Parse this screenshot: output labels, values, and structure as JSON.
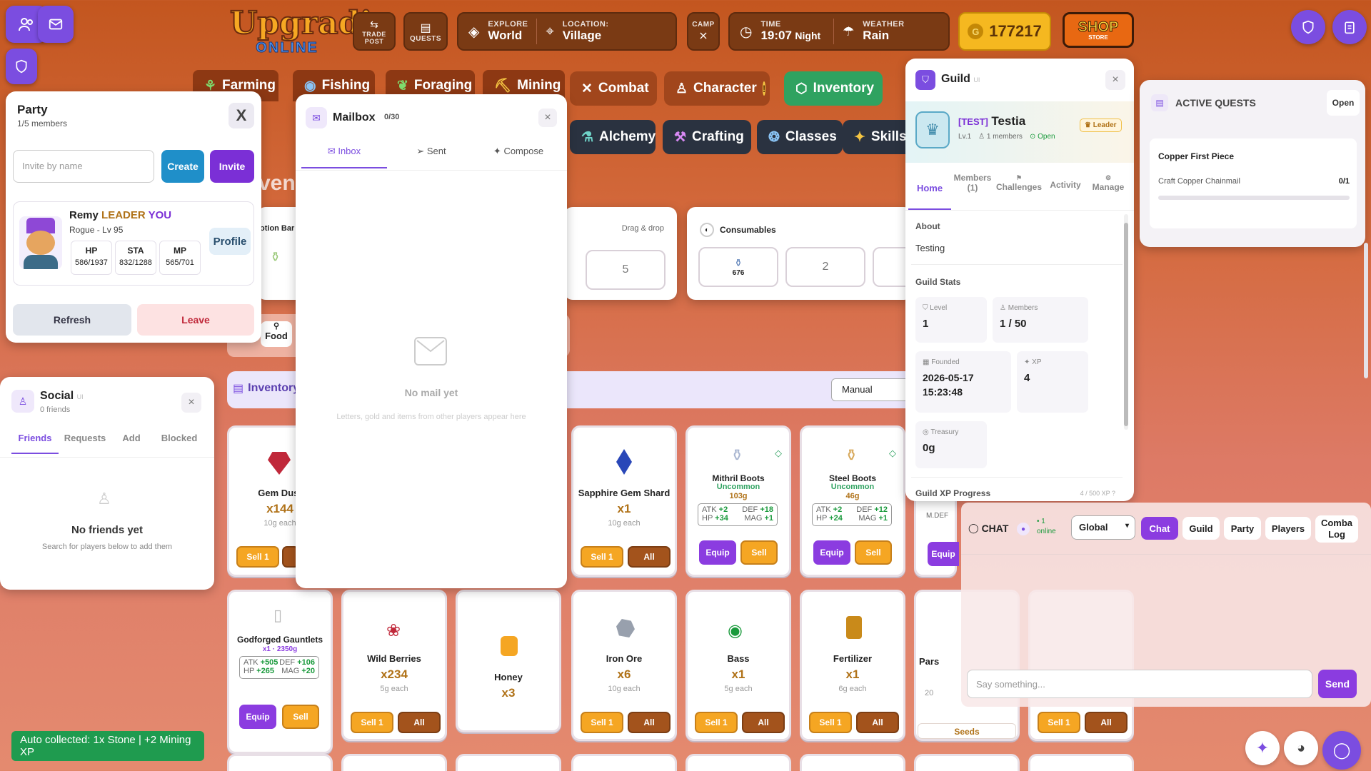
{
  "top_bar": {
    "logo_line1": "Upgradia",
    "logo_line2": "ONLINE",
    "trade_post_line1": "TRADE",
    "trade_post_line2": "POST",
    "quests": "QUESTS",
    "explore_label": "EXPLORE",
    "explore_value": "World",
    "location_label": "LOCATION:",
    "location_value": "Village",
    "camp": "CAMP",
    "time_label": "TIME",
    "time_value": "19:07",
    "time_period": "Night",
    "weather_label": "WEATHER",
    "weather_value": "Rain",
    "gold": "177217",
    "shop_label": "SHOP",
    "shop_sub": "STORE"
  },
  "skill_tabs": [
    {
      "label": "Farming",
      "icon": "sprout-icon"
    },
    {
      "label": "Fishing",
      "icon": "fish-icon"
    },
    {
      "label": "Foraging",
      "icon": "leaf-icon"
    },
    {
      "label": "Mining",
      "icon": "pickaxe-icon"
    },
    {
      "label": "Combat",
      "icon": "swords-icon"
    },
    {
      "label": "Character",
      "icon": "person-icon"
    },
    {
      "label": "Inventory",
      "icon": "box-icon"
    }
  ],
  "skill_tabs_row2": [
    {
      "label": "Alchemy",
      "icon": "flask-icon"
    },
    {
      "label": "Crafting",
      "icon": "hammer-icon"
    },
    {
      "label": "Classes",
      "icon": "classes-icon"
    },
    {
      "label": "Skills",
      "icon": "sparkle-icon"
    }
  ],
  "party": {
    "title": "Party",
    "members_count": "1/5 members",
    "close": "X",
    "invite_placeholder": "Invite by name",
    "create": "Create",
    "invite": "Invite",
    "member_name": "Remy",
    "leader_tag": "LEADER",
    "you_tag": "YOU",
    "member_class": "Rogue - Lv 95",
    "hp_label": "HP",
    "hp_value": "586/1937",
    "sta_label": "STA",
    "sta_value": "832/1288",
    "mp_label": "MP",
    "mp_value": "565/701",
    "profile": "Profile",
    "refresh": "Refresh",
    "leave": "Leave"
  },
  "mailbox": {
    "title": "Mailbox",
    "count": "0/30",
    "close": "×",
    "tabs": [
      "Inbox",
      "Sent",
      "Compose"
    ],
    "empty_title": "No mail yet",
    "empty_sub": "Letters, gold and items from other players appear here"
  },
  "social": {
    "title": "Social",
    "ui_tag": "UI",
    "friends_count": "0 friends",
    "close": "×",
    "tabs": [
      "Friends",
      "Requests",
      "Add",
      "Blocked"
    ],
    "empty_title": "No friends yet",
    "empty_sub": "Search for players below to add them"
  },
  "guild": {
    "title": "Guild",
    "ui_tag": "UI",
    "close": "×",
    "name_tag": "[TEST]",
    "name": "Testia",
    "level": "Lv.1",
    "members": "1 members",
    "open": "Open",
    "leader": "Leader",
    "tabs": [
      "Home",
      "Members (1)",
      "Challenges",
      "Activity",
      "Manage"
    ],
    "about_label": "About",
    "about_text": "Testing",
    "stats_label": "Guild Stats",
    "level_label": "Level",
    "level_value": "1",
    "members_label": "Members",
    "members_value": "1 / 50",
    "founded_label": "Founded",
    "founded_date": "2026-05-17",
    "founded_time": "15:23:48",
    "xp_label": "XP",
    "xp_value": "4",
    "treasury_label": "Treasury",
    "treasury_value": "0g",
    "progress_label": "Guild XP Progress",
    "progress_value": "4 / 500 XP ?"
  },
  "quests": {
    "title": "ACTIVE QUESTS",
    "open": "Open",
    "quest_name": "Copper First Piece",
    "quest_task": "Craft Copper Chainmail",
    "quest_progress": "0/1",
    "quest_fraction": 0
  },
  "bars": {
    "potion_bar": "otion Bar",
    "drag_drop": "Drag & drop",
    "slot_5": "5",
    "consumables": "Consumables",
    "consumable_count": "676",
    "slot_2": "2",
    "food": "Food",
    "vent": "vent"
  },
  "inventory": {
    "title": "Inventory",
    "sort": "Manual"
  },
  "items_row1": [
    {
      "name": "Gem Dust",
      "qty": "x144",
      "price": "10g each",
      "sell": "Sell 1",
      "all": "All"
    },
    {
      "name": "Sapphire Gem Shard",
      "qty": "x1",
      "price": "10g each",
      "sell": "Sell 1",
      "all": "All"
    },
    {
      "name": "Mithril Boots",
      "rarity": "Uncommon",
      "price": "103g",
      "atk": "+2",
      "def": "+18",
      "hp": "+34",
      "mag": "+1",
      "equip": "Equip",
      "sell": "Sell"
    },
    {
      "name": "Steel Boots",
      "rarity": "Uncommon",
      "price": "46g",
      "atk": "+2",
      "def": "+12",
      "hp": "+24",
      "mag": "+1",
      "equip": "Equip",
      "sell": "Sell"
    }
  ],
  "items_row2": [
    {
      "name": "Godforged Gauntlets",
      "qty_price": "x1 · 2350g",
      "atk": "+505",
      "def": "+106",
      "hp": "+265",
      "mag": "+20",
      "equip": "Equip",
      "sell": "Sell"
    },
    {
      "name": "Wild Berries",
      "qty": "x234",
      "price": "5g each",
      "sell": "Sell 1",
      "all": "All"
    },
    {
      "name": "Honey",
      "qty": "x3"
    },
    {
      "name": "Iron Ore",
      "qty": "x6",
      "price": "10g each",
      "sell": "Sell 1",
      "all": "All"
    },
    {
      "name": "Bass",
      "qty": "x1",
      "price": "5g each",
      "sell": "Sell 1",
      "all": "All"
    },
    {
      "name": "Fertilizer",
      "qty": "x1",
      "price": "6g each",
      "sell": "Sell 1",
      "all": "All"
    },
    {
      "name": "Pars",
      "price": "20",
      "seeds": "Seeds"
    },
    {
      "sell": "Sell 1",
      "all": "All"
    }
  ],
  "stat_labels": {
    "atk": "ATK",
    "def": "DEF",
    "hp": "HP",
    "mag": "MAG",
    "mdef": "M.DEF"
  },
  "partial_equip": "Equip",
  "chat": {
    "title": "CHAT",
    "online_count": "• 1",
    "online_label": "online",
    "channel": "Global",
    "tabs": [
      "Chat",
      "Guild",
      "Party",
      "Players"
    ],
    "combat_log_1": "Comba",
    "combat_log_2": "Log",
    "placeholder": "Say something...",
    "send": "Send"
  },
  "toast": "Auto collected: 1x Stone | +2 Mining XP",
  "colors": {
    "accent": "#7b4de0",
    "sell": "#f5a623",
    "all": "#a3531c",
    "equip": "#8b3ce0",
    "toast": "#1f9b4f"
  }
}
